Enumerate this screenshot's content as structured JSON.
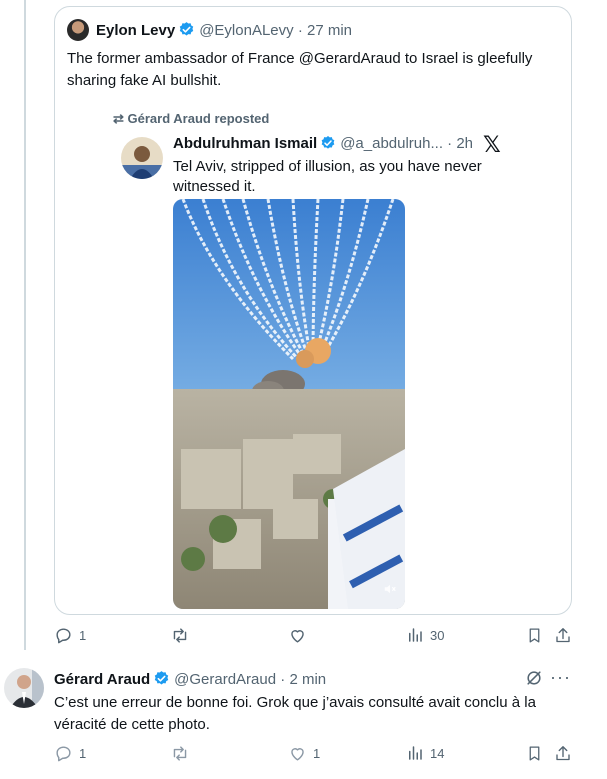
{
  "quoted_tweet": {
    "author_name": "Eylon Levy",
    "author_handle": "@EylonALevy",
    "time": "27 min",
    "text": "The former ambassador of France @GerardAraud to Israel is gleefully sharing fake AI bullshit."
  },
  "embedded_tweet": {
    "repost_label": "Gérard Araud reposted",
    "author_name": "Abdulruhman Ismail",
    "author_handle": "@a_abdulruh...",
    "time": "2h",
    "platform_icon": "x-logo",
    "text": "Tel Aviv, stripped of illusion, as you have never witnessed it."
  },
  "actions_top": {
    "replies": "1",
    "retweets": "",
    "likes": "",
    "views": "30"
  },
  "reply_tweet": {
    "author_name": "Gérard Araud",
    "author_handle": "@GerardAraud",
    "time": "2 min",
    "text": "C’est une erreur de bonne foi. Grok que j’avais consulté avait conclu à la véracité de cette photo."
  },
  "actions_bottom": {
    "replies": "1",
    "retweets": "",
    "likes": "1",
    "views": "14"
  },
  "colors": {
    "accent": "#1d9bf0",
    "muted": "#536471",
    "border": "#cfd9de"
  }
}
